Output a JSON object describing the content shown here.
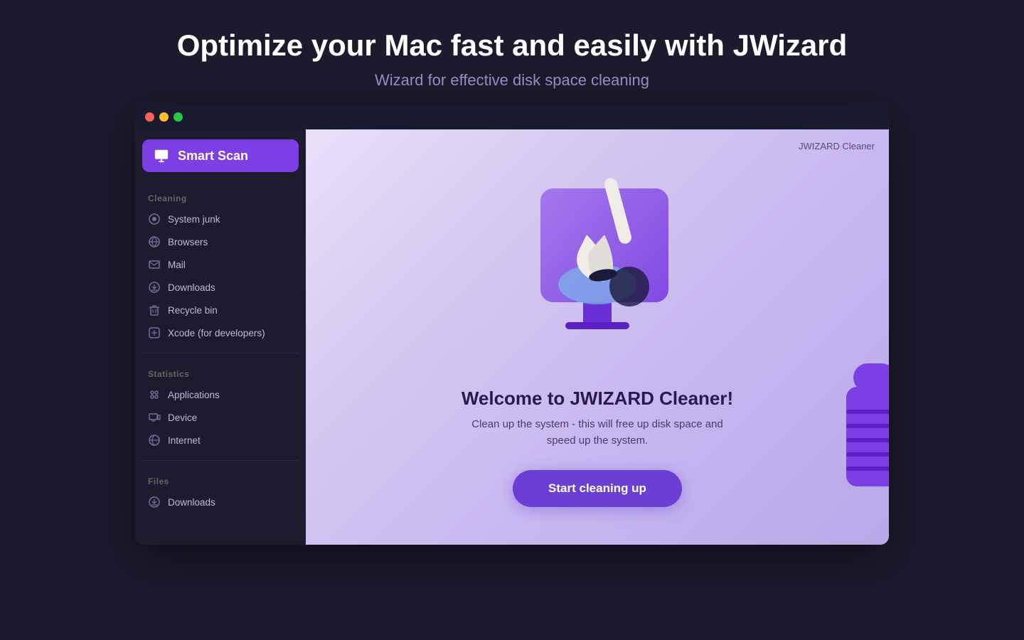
{
  "header": {
    "title": "Optimize your Mac fast and easily with JWizard",
    "subtitle": "Wizard for effective disk space cleaning"
  },
  "titlebar": {
    "traffic_lights": [
      "red",
      "yellow",
      "green"
    ]
  },
  "sidebar": {
    "smart_scan_label": "Smart Scan",
    "sections": [
      {
        "label": "Cleaning",
        "items": [
          {
            "label": "System junk",
            "icon": "system-icon"
          },
          {
            "label": "Browsers",
            "icon": "browser-icon"
          },
          {
            "label": "Mail",
            "icon": "mail-icon"
          },
          {
            "label": "Downloads",
            "icon": "download-icon"
          },
          {
            "label": "Recycle bin",
            "icon": "trash-icon"
          },
          {
            "label": "Xcode (for developers)",
            "icon": "xcode-icon"
          }
        ]
      },
      {
        "label": "Statistics",
        "items": [
          {
            "label": "Applications",
            "icon": "apps-icon"
          },
          {
            "label": "Device",
            "icon": "device-icon"
          },
          {
            "label": "Internet",
            "icon": "internet-icon"
          }
        ]
      },
      {
        "label": "Files",
        "items": [
          {
            "label": "Downloads",
            "icon": "download-icon"
          }
        ]
      }
    ]
  },
  "main": {
    "app_label": "JWIZARD Cleaner",
    "welcome_title": "Welcome to JWIZARD Cleaner!",
    "welcome_desc": "Clean up the system - this will free up disk space and\nspeed up the system.",
    "cta_button": "Start cleaning up"
  },
  "colors": {
    "accent_purple": "#7b3fe4",
    "bg_dark": "#1e1a2e",
    "sidebar_bg": "#1c1c2e",
    "main_gradient_start": "#e8e0f8",
    "main_gradient_end": "#b8a8e8"
  }
}
